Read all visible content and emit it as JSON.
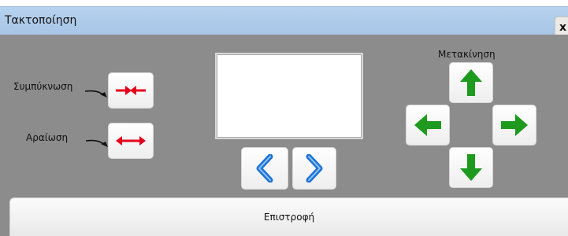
{
  "window": {
    "title": "Τακτοποίηση",
    "close_label": "x"
  },
  "panel": {
    "compress_label": "Συμπύκνωση",
    "spread_label": "Αραίωση",
    "move_label": "Μετακίνηση",
    "return_label": "Επιστροφή"
  },
  "icons": {
    "compress": "arrows-inward-icon",
    "spread": "double-arrow-icon",
    "prev": "chevron-left-icon",
    "next": "chevron-right-icon",
    "up": "arrow-up-icon",
    "down": "arrow-down-icon",
    "left": "arrow-left-icon",
    "right": "arrow-right-icon"
  },
  "colors": {
    "titlebar": "#aecbeb",
    "panel": "#8c8c8c",
    "red_arrow": "#e4001b",
    "green_arrow": "#1e9a1e",
    "blue_chevron": "#1e73d6"
  }
}
